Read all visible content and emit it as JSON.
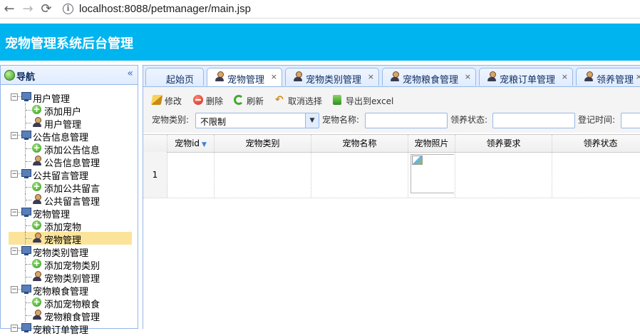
{
  "browser": {
    "back": "←",
    "forward": "→",
    "reload": "⟳",
    "info": "i",
    "url": "localhost:8088/petmanager/main.jsp"
  },
  "header": {
    "title": "宠物管理系统后台管理"
  },
  "nav": {
    "title": "导航",
    "collapse_glyph": "«",
    "tree": [
      {
        "label": "用户管理",
        "type": "parent",
        "expander": "−"
      },
      {
        "label": "添加用户",
        "type": "add"
      },
      {
        "label": "用户管理",
        "type": "user"
      },
      {
        "label": "公告信息管理",
        "type": "parent",
        "expander": "−"
      },
      {
        "label": "添加公告信息",
        "type": "add"
      },
      {
        "label": "公告信息管理",
        "type": "user"
      },
      {
        "label": "公共留言管理",
        "type": "parent",
        "expander": "−"
      },
      {
        "label": "添加公共留言",
        "type": "add"
      },
      {
        "label": "公共留言管理",
        "type": "user"
      },
      {
        "label": "宠物管理",
        "type": "parent",
        "expander": "−"
      },
      {
        "label": "添加宠物",
        "type": "add"
      },
      {
        "label": "宠物管理",
        "type": "user",
        "selected": true
      },
      {
        "label": "宠物类别管理",
        "type": "parent",
        "expander": "−"
      },
      {
        "label": "添加宠物类别",
        "type": "add"
      },
      {
        "label": "宠物类别管理",
        "type": "user"
      },
      {
        "label": "宠物粮食管理",
        "type": "parent",
        "expander": "−"
      },
      {
        "label": "添加宠物粮食",
        "type": "add"
      },
      {
        "label": "宠物粮食管理",
        "type": "user"
      },
      {
        "label": "宠粮订单管理",
        "type": "parent",
        "expander": "−"
      }
    ]
  },
  "tabs": [
    {
      "label": "起始页",
      "closable": false,
      "icon": false
    },
    {
      "label": "宠物管理",
      "closable": true,
      "icon": true,
      "active": true
    },
    {
      "label": "宠物类别管理",
      "closable": true,
      "icon": true
    },
    {
      "label": "宠物粮食管理",
      "closable": true,
      "icon": true
    },
    {
      "label": "宠粮订单管理",
      "closable": true,
      "icon": true
    },
    {
      "label": "领养管理",
      "closable": true,
      "icon": true
    }
  ],
  "close_glyph": "×",
  "toolbar": {
    "edit": "修改",
    "delete": "删除",
    "refresh": "刷新",
    "cancel_select": "取消选择",
    "export": "导出到excel"
  },
  "search": {
    "category_label": "宠物类别:",
    "category_value": "不限制",
    "name_label": "宠物名称:",
    "name_value": "",
    "adopt_status_label": "领养状态:",
    "adopt_status_value": "",
    "register_time_label": "登记时间:",
    "register_time_value": ""
  },
  "grid": {
    "columns": [
      "宠物id",
      "宠物类别",
      "宠物名称",
      "宠物照片",
      "领养要求",
      "领养状态"
    ],
    "sort_glyph": "▼",
    "rows": [
      {
        "num": "1",
        "cells": [
          "",
          "",
          "",
          "",
          "",
          ""
        ]
      }
    ]
  },
  "colors": {
    "header_bg": "#00b4ef",
    "panel_border": "#95b8e7",
    "selected_row": "#fbe49a"
  }
}
